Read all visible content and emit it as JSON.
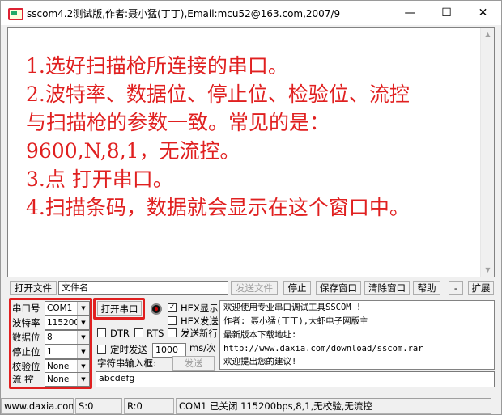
{
  "window": {
    "title": "sscom4.2测试版,作者:聂小猛(丁丁),Email:mcu52@163.com,2007/9",
    "minimize": "—",
    "maximize": "☐",
    "close": "✕"
  },
  "receive": {
    "lines": "1.选好扫描枪所连接的串口。\n2.波特率、数据位、停止位、检验位、流控\n与扫描枪的参数一致。常见的是：\n9600,N,8,1，无流控。\n3.点 打开串口。\n4.扫描条码，数据就会显示在这个窗口中。"
  },
  "toolbar": {
    "open_file": "打开文件",
    "file_name": "文件名",
    "send_file": "发送文件",
    "stop": "停止",
    "save_window": "保存窗口",
    "clear_window": "清除窗口",
    "help": "帮助",
    "minus": "-",
    "expand": "扩展"
  },
  "settings": {
    "port_label": "串口号",
    "port_value": "COM1",
    "baud_label": "波特率",
    "baud_value": "115200",
    "databits_label": "数据位",
    "databits_value": "8",
    "stopbits_label": "停止位",
    "stopbits_value": "1",
    "parity_label": "校验位",
    "parity_value": "None",
    "flow_label": "流 控",
    "flow_value": "None"
  },
  "controls": {
    "open_port": "打开串口",
    "hex_display": "HEX显示",
    "hex_send": "HEX发送",
    "send_newline": "发送新行",
    "dtr": "DTR",
    "rts": "RTS",
    "timed_send": "定时发送",
    "interval_value": "1000",
    "interval_unit": "ms/次",
    "string_input_label": "字符串输入框:",
    "send": "发送",
    "send_text": "abcdefg"
  },
  "info": {
    "line1": "欢迎使用专业串口调试工具SSCOM !",
    "line2": "作者: 聂小猛(丁丁),大虾电子网版主",
    "line3": "最新版本下载地址:",
    "line4": "http://www.daxia.com/download/sscom.rar",
    "line5": "欢迎提出您的建议!"
  },
  "status": {
    "site": "www.daxia.com",
    "sent": "S:0",
    "received": "R:0",
    "port_status": "COM1 已关闭  115200bps,8,1,无校验,无流控"
  },
  "colors": {
    "accent_red": "#e02020"
  }
}
